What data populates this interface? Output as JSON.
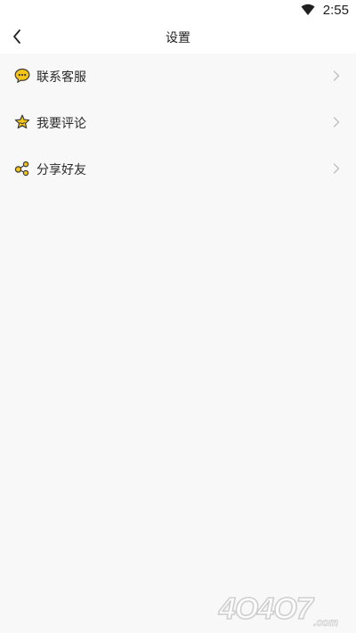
{
  "status_bar": {
    "time": "2:55"
  },
  "header": {
    "title": "设置"
  },
  "menu": {
    "items": [
      {
        "label": "联系客服",
        "icon": "chat-bubble-icon"
      },
      {
        "label": "我要评论",
        "icon": "star-icon"
      },
      {
        "label": "分享好友",
        "icon": "share-icon"
      }
    ]
  },
  "watermark": {
    "text": "4O4O7.com"
  },
  "colors": {
    "icon_yellow": "#f5c518",
    "icon_outline": "#3a3a3a",
    "background": "#f8f8f8",
    "chevron": "#bdbdbd"
  }
}
